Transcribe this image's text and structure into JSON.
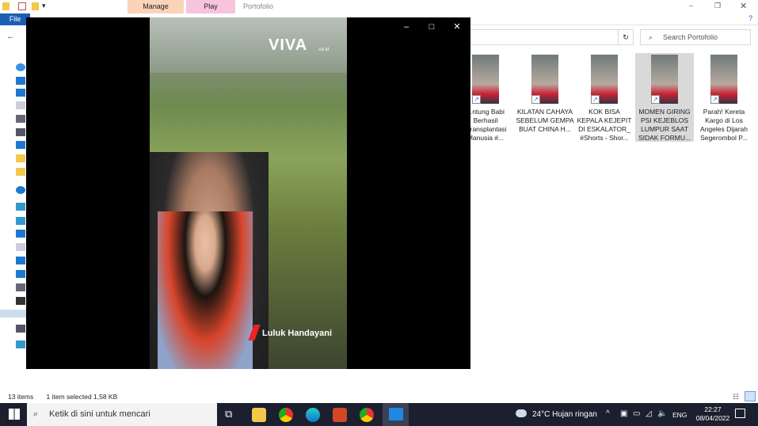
{
  "explorer": {
    "context_tabs": [
      {
        "label": "Manage",
        "color": "#fbd3b9"
      },
      {
        "label": "Play",
        "color": "#f8c4dd"
      }
    ],
    "window_title": "Portofolio",
    "file_tab": "File",
    "search_placeholder": "Search Portofolio",
    "items": [
      {
        "label": "...ntung Babi Berhasil ...ransplantasi Manusia #...",
        "selected": false
      },
      {
        "label": "KILATAN CAHAYA SEBELUM GEMPA BUAT CHINA H...",
        "selected": false
      },
      {
        "label": "KOK BISA KEPALA KEJEPIT DI ESKALATOR_ #Shorts - Shor...",
        "selected": false
      },
      {
        "label": "MOMEN GIRING PSI KEJEBLOS LUMPUR SAAT SIDAK FORMU...",
        "selected": true
      },
      {
        "label": "Parah! Kereta Kargo di Los Angeles Dijarah Segerombol P...",
        "selected": false
      }
    ],
    "status": {
      "count": "13 items",
      "selection": "1 item selected  1,58 KB"
    }
  },
  "player": {
    "watermark": "VIVA",
    "watermark_sub": ".co.id",
    "presenter": "Luluk Handayani",
    "buttons": {
      "minimize": "–",
      "maximize": "□",
      "close": "✕"
    }
  },
  "taskbar": {
    "search_placeholder": "Ketik di sini untuk mencari",
    "weather": "24°C  Hujan ringan",
    "language": "ENG",
    "time": "22:27",
    "date": "08/04/2022"
  }
}
